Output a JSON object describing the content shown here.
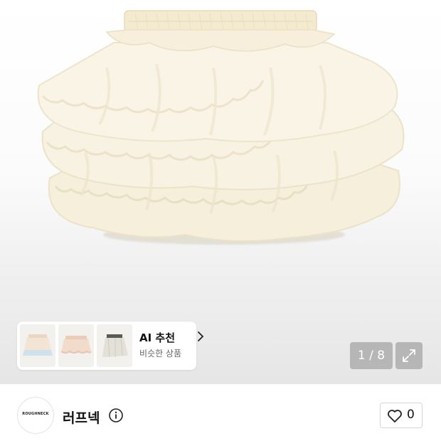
{
  "product": {
    "image_icon": "ruffle-tutu-skirt",
    "image_index": 1,
    "image_total": 8,
    "counter_text": "1 / 8"
  },
  "ai_recommend": {
    "title": "AI 추천",
    "subtitle": "비슷한 상품",
    "thumbnails": [
      {
        "icon": "tiered-skirt-thumbnail"
      },
      {
        "icon": "pink-skirt-thumbnail"
      },
      {
        "icon": "sheer-skirt-thumbnail"
      }
    ]
  },
  "shop": {
    "logo_text": "ROUGHNECK",
    "name": "러프넥",
    "like_count": "0"
  },
  "icons": {
    "chevron": "chevron-right-icon",
    "expand": "expand-icon",
    "info": "info-icon",
    "heart": "heart-icon"
  },
  "colors": {
    "skirt": "#f7f0de",
    "skirt_edge": "#ebe1c6"
  }
}
